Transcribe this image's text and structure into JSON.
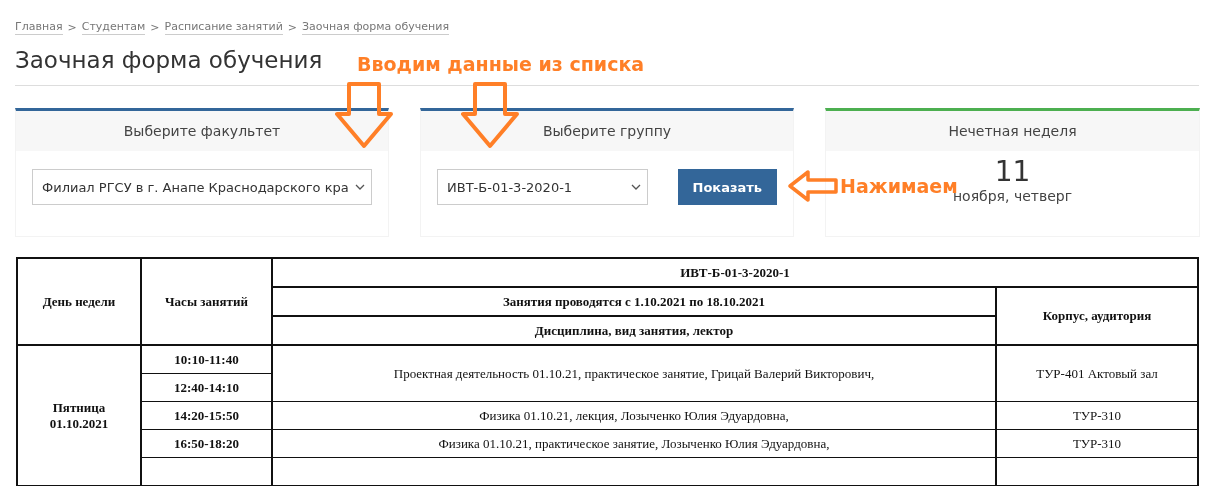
{
  "breadcrumbs": [
    "Главная",
    "Студентам",
    "Расписание занятий",
    "Заочная форма обучения"
  ],
  "breadcrumb_separator": ">",
  "title": "Заочная форма обучения",
  "faculty": {
    "label": "Выберите факультет",
    "value": "Филиал РГСУ в г. Анапе Краснодарского кра"
  },
  "group": {
    "label": "Выберите группу",
    "value": "ИВТ-Б-01-3-2020-1",
    "button": "Показать"
  },
  "week": {
    "label": "Нечетная неделя",
    "day": "11",
    "date": "ноября, четверг"
  },
  "annotations": {
    "select_hint": "Вводим данные из списка",
    "click_hint": "Нажимаем"
  },
  "schedule": {
    "columns": [
      "День недели",
      "Часы занятий",
      "Дисциплина, вид занятия, лектор",
      "Корпус, аудитория"
    ],
    "group": "ИВТ-Б-01-3-2020-1",
    "period": "Занятия проводятся с 1.10.2021 по 18.10.2021",
    "days": [
      {
        "day": "Пятница",
        "date": "01.10.2021",
        "slots": [
          {
            "times": [
              "10:10-11:40",
              "12:40-14:10"
            ],
            "lesson": "Проектная деятельность 01.10.21, практическое занятие, Грицай Валерий Викторович,",
            "room": "ТУР-401 Актовый зал"
          },
          {
            "times": [
              "14:20-15:50"
            ],
            "lesson": "Физика 01.10.21, лекция, Лозыченко Юлия Эдуардовна,",
            "room": "ТУР-310"
          },
          {
            "times": [
              "16:50-18:20"
            ],
            "lesson": "Физика 01.10.21, практическое занятие, Лозыченко Юлия Эдуардовна,",
            "room": "ТУР-310"
          }
        ]
      }
    ]
  }
}
